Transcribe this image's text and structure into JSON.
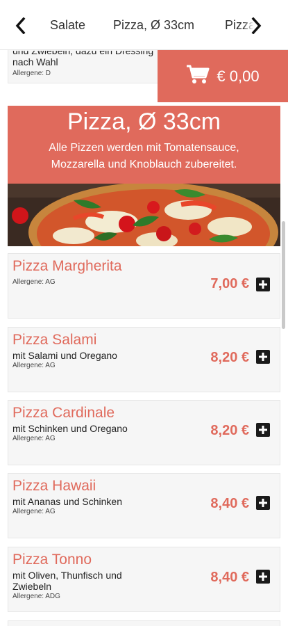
{
  "nav": {
    "tabs": [
      "Salate",
      "Pizza, Ø 33cm",
      "Pizza"
    ]
  },
  "previous_item": {
    "desc_line1": "und Zwiebeln, dazu ein Dressing",
    "desc_line2": "nach Wahl",
    "allergen": "Allergene: D"
  },
  "cart": {
    "total": "€ 0,00"
  },
  "category": {
    "title": "Pizza, Ø 33cm",
    "subtitle_line1": "Alle Pizzen werden mit Tomatensauce,",
    "subtitle_line2": "Mozzarella und Knoblauch zubereitet."
  },
  "items": [
    {
      "name": "Pizza Margherita",
      "desc_lines": [],
      "allergen": "Allergene: AG",
      "price": "7,00 €"
    },
    {
      "name": "Pizza Salami",
      "desc_lines": [
        "mit Salami und Oregano"
      ],
      "allergen": "Allergene: AG",
      "price": "8,20 €"
    },
    {
      "name": "Pizza Cardinale",
      "desc_lines": [
        "mit Schinken und Oregano"
      ],
      "allergen": "Allergene: AG",
      "price": "8,20 €"
    },
    {
      "name": "Pizza Hawaii",
      "desc_lines": [
        "mit Ananas und Schinken"
      ],
      "allergen": "Allergene: AG",
      "price": "8,40 €"
    },
    {
      "name": "Pizza Tonno",
      "desc_lines": [
        "mit Oliven, Thunfisch und",
        "Zwiebeln"
      ],
      "allergen": "Allergene: ADG",
      "price": "8,40 €"
    }
  ],
  "colors": {
    "accent": "#e06a5c",
    "item_bg": "#f6f6f6",
    "text": "#222222"
  },
  "icons": {
    "nav_left": "chevron-left-icon",
    "nav_right": "chevron-right-icon",
    "cart": "shopping-cart-icon",
    "add": "plus-square-icon"
  }
}
